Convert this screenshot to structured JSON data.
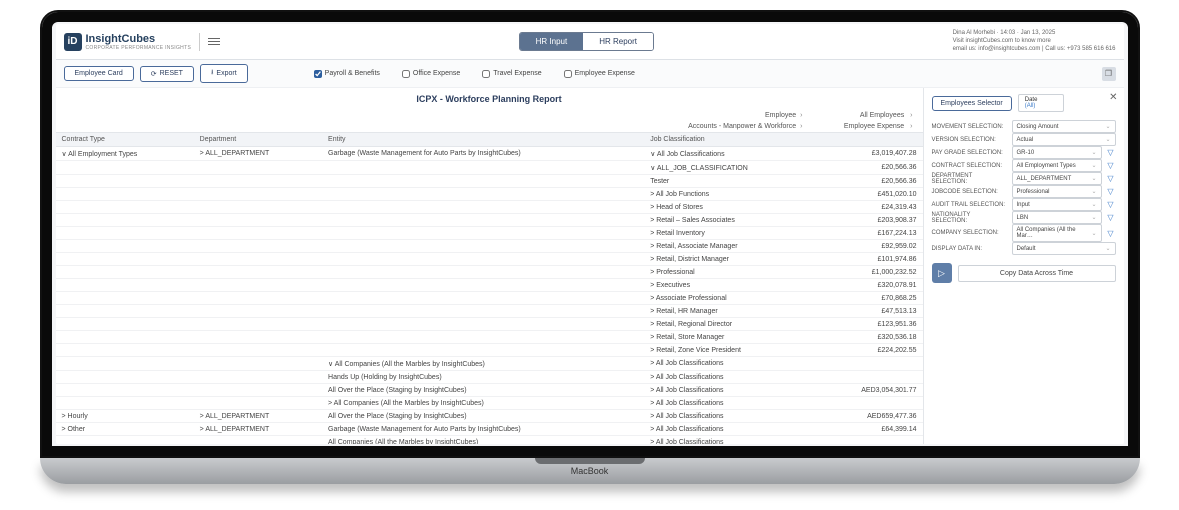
{
  "brand": {
    "name": "InsightCubes",
    "tagline": "CORPORATE PERFORMANCE INSIGHTS",
    "logo_glyph": "iD"
  },
  "tabs": {
    "input": "HR Input",
    "report": "HR Report"
  },
  "userinfo": {
    "line1": "Dina Al Morhebi · 14:03 · Jan 13, 2025",
    "line2": "Visit insightCubes.com to know more",
    "line3": "email us: info@insightcubes.com | Call us: +973 585 616 616"
  },
  "toolbar": {
    "employee_card": "Employee Card",
    "reset": "RESET",
    "export": "Export",
    "checks": [
      {
        "label": "Payroll & Benefits",
        "checked": true
      },
      {
        "label": "Office Expense",
        "checked": false
      },
      {
        "label": "Travel Expense",
        "checked": false
      },
      {
        "label": "Employee Expense",
        "checked": false
      }
    ]
  },
  "report": {
    "title": "ICPX - Workforce Planning Report",
    "dims": [
      {
        "left": "Employee",
        "right": "All Employees"
      },
      {
        "left": "Accounts - Manpower & Workforce",
        "right": "Employee Expense"
      }
    ],
    "columns": [
      "Contract Type",
      "Department",
      "Entity",
      "Job Classification",
      ""
    ],
    "rows": [
      {
        "c": [
          "∨ All Employment Types",
          "> ALL_DEPARTMENT",
          "Garbage (Waste Management for Auto Parts by InsightCubes)",
          "∨ All Job Classifications",
          "£3,019,407.28"
        ]
      },
      {
        "c": [
          "",
          "",
          "",
          "∨ ALL_JOB_CLASSIFICATION",
          "£20,566.36"
        ]
      },
      {
        "c": [
          "",
          "",
          "",
          "  Tester",
          "£20,566.36"
        ]
      },
      {
        "c": [
          "",
          "",
          "",
          "> All Job Functions",
          "£451,020.10"
        ]
      },
      {
        "c": [
          "",
          "",
          "",
          "> Head of Stores",
          "£24,319.43"
        ]
      },
      {
        "c": [
          "",
          "",
          "",
          "> Retail – Sales Associates",
          "£203,908.37"
        ]
      },
      {
        "c": [
          "",
          "",
          "",
          "> Retail Inventory",
          "£167,224.13"
        ]
      },
      {
        "c": [
          "",
          "",
          "",
          "> Retail, Associate Manager",
          "£92,959.02"
        ]
      },
      {
        "c": [
          "",
          "",
          "",
          "> Retail, District Manager",
          "£101,974.86"
        ]
      },
      {
        "c": [
          "",
          "",
          "",
          "> Professional",
          "£1,000,232.52"
        ]
      },
      {
        "c": [
          "",
          "",
          "",
          "> Executives",
          "£320,078.91"
        ]
      },
      {
        "c": [
          "",
          "",
          "",
          "> Associate Professional",
          "£70,868.25"
        ]
      },
      {
        "c": [
          "",
          "",
          "",
          "> Retail, HR Manager",
          "£47,513.13"
        ]
      },
      {
        "c": [
          "",
          "",
          "",
          "> Retail, Regional Director",
          "£123,951.36"
        ]
      },
      {
        "c": [
          "",
          "",
          "",
          "> Retail, Store Manager",
          "£320,536.18"
        ]
      },
      {
        "c": [
          "",
          "",
          "",
          "> Retail, Zone Vice President",
          "£224,202.55"
        ]
      },
      {
        "c": [
          "",
          "",
          "∨ All Companies (All the Marbles by InsightCubes)",
          "> All Job Classifications",
          ""
        ]
      },
      {
        "c": [
          "",
          "",
          "  Hands Up (Holding by InsightCubes)",
          "> All Job Classifications",
          ""
        ]
      },
      {
        "c": [
          "",
          "",
          "  All Over the Place (Staging by InsightCubes)",
          "> All Job Classifications",
          "AED3,054,301.77"
        ]
      },
      {
        "c": [
          "",
          "",
          "> All Companies (All the Marbles by InsightCubes)",
          "> All Job Classifications",
          ""
        ]
      },
      {
        "c": [
          "> Hourly",
          "> ALL_DEPARTMENT",
          "All Over the Place (Staging by InsightCubes)",
          "> All Job Classifications",
          "AED659,477.36"
        ]
      },
      {
        "c": [
          "> Other",
          "> ALL_DEPARTMENT",
          "Garbage (Waste Management for Auto Parts by InsightCubes)",
          "> All Job Classifications",
          "£64,399.14"
        ]
      },
      {
        "c": [
          "",
          "",
          "All Companies (All the Marbles by InsightCubes)",
          "> All Job Classifications",
          ""
        ]
      }
    ]
  },
  "side": {
    "employees_selector": "Employees Selector",
    "date_label": "Date",
    "date_value": "(All)",
    "close": "✕",
    "selectors": [
      {
        "label": "MOVEMENT SELECTION:",
        "value": "Closing Amount",
        "icon": false
      },
      {
        "label": "VERSION SELECTION:",
        "value": "Actual",
        "icon": false
      },
      {
        "label": "PAY GRADE SELECTION:",
        "value": "GR-10",
        "icon": true
      },
      {
        "label": "CONTRACT SELECTION:",
        "value": "All Employment Types",
        "icon": true
      },
      {
        "label": "DEPARTMENT SELECTION:",
        "value": "ALL_DEPARTMENT",
        "icon": true
      },
      {
        "label": "JOBCODE SELECTION:",
        "value": "Professional",
        "icon": true
      },
      {
        "label": "AUDIT TRAIL SELECTION:",
        "value": "Input",
        "icon": true
      },
      {
        "label": "NATIONALITY SELECTION:",
        "value": "LBN",
        "icon": true
      },
      {
        "label": "COMPANY SELECTION:",
        "value": "All Companies (All the Mar…",
        "icon": true
      },
      {
        "label": "DISPLAY DATA IN:",
        "value": "Default",
        "icon": false
      }
    ],
    "action": "Copy Data Across Time"
  }
}
